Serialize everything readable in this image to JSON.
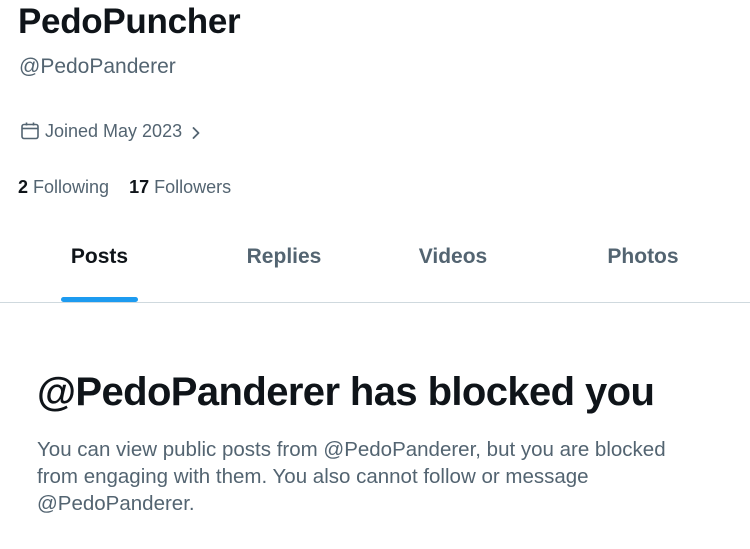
{
  "profile": {
    "display_name": "PedoPuncher",
    "handle": "@PedoPanderer",
    "joined": "Joined May 2023",
    "following_count": "2",
    "following_label": "Following",
    "followers_count": "17",
    "followers_label": "Followers"
  },
  "tabs": [
    {
      "label": "Posts",
      "active": true
    },
    {
      "label": "Replies",
      "active": false
    },
    {
      "label": "Videos",
      "active": false
    },
    {
      "label": "Photos",
      "active": false
    }
  ],
  "blocked": {
    "title": "@PedoPanderer has blocked you",
    "description": "You can view public posts from @PedoPanderer, but you are blocked from engaging with them. You also cannot follow or message @PedoPanderer."
  },
  "icons": {
    "joined": "calendar-icon",
    "joined_chevron": "chevron-right-icon"
  },
  "colors": {
    "accent": "#1d9bf0",
    "primary_text": "#0f1419",
    "secondary_text": "#536471",
    "divider": "#cfd9de"
  }
}
